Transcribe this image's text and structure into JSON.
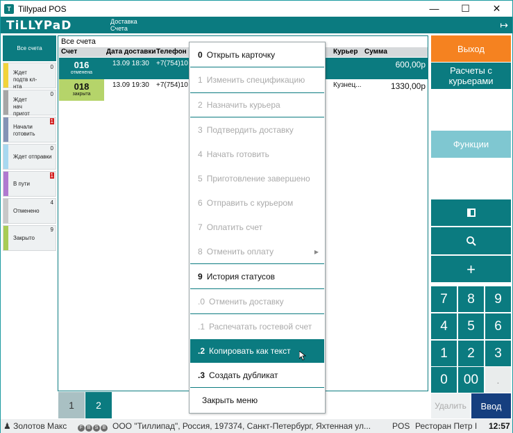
{
  "window": {
    "title": "Tillypad POS"
  },
  "header": {
    "logo": "TiLLYPaD",
    "section": "Доставка",
    "subsection": "Счета"
  },
  "sidebar": {
    "items": [
      {
        "label": "Все счета",
        "count": "",
        "color": ""
      },
      {
        "label": "Ждет подтв кл-нта",
        "count": "0",
        "color": "#f2d33a"
      },
      {
        "label": "Ждет нач пригот",
        "count": "0",
        "color": "#a6a6a6"
      },
      {
        "label": "Начали готовить",
        "count": "1",
        "color": "#8493b5",
        "alert": true
      },
      {
        "label": "Ждет отправки",
        "count": "0",
        "color": "#a8d8f0"
      },
      {
        "label": "В пути",
        "count": "1",
        "color": "#b07ad0",
        "alert": true
      },
      {
        "label": "Отменено",
        "count": "4",
        "color": "#c8c8c8"
      },
      {
        "label": "Закрыто",
        "count": "9",
        "color": "#a8cc55"
      }
    ]
  },
  "table": {
    "caption": "Все счета",
    "columns": [
      "Счет",
      "Дата доставки",
      "Телефон",
      "Курьер",
      "Сумма"
    ],
    "rows": [
      {
        "num": "016",
        "status": "отменена",
        "date": "13.09 18:30",
        "phone": "+7(754)10",
        "courier": "",
        "sum": "600,00р"
      },
      {
        "num": "018",
        "status": "закрыта",
        "date": "13.09 19:30",
        "phone": "+7(754)10",
        "courier": "Кузнец...",
        "sum": "1330,00р"
      }
    ]
  },
  "pager": {
    "pages": [
      "1",
      "2"
    ],
    "active": "2"
  },
  "right_panel": {
    "exit": "Выход",
    "couriers": "Расчеты с курьерами",
    "functions": "Функции",
    "delete": "Удалить",
    "enter": "Ввод",
    "keys": [
      "7",
      "8",
      "9",
      "4",
      "5",
      "6",
      "1",
      "2",
      "3",
      "0",
      "00",
      "."
    ],
    "plus": "+"
  },
  "context_menu": {
    "items": [
      {
        "key": "0",
        "label": "Открыть карточку",
        "enabled": true
      },
      {
        "key": "1",
        "label": "Изменить спецификацию",
        "enabled": false
      },
      {
        "key": "2",
        "label": "Назначить курьера",
        "enabled": false
      },
      {
        "key": "3",
        "label": "Подтвердить доставку",
        "enabled": false
      },
      {
        "key": "4",
        "label": "Начать готовить",
        "enabled": false
      },
      {
        "key": "5",
        "label": "Приготовление завершено",
        "enabled": false
      },
      {
        "key": "6",
        "label": "Отправить с курьером",
        "enabled": false
      },
      {
        "key": "7",
        "label": "Оплатить счет",
        "enabled": false
      },
      {
        "key": "8",
        "label": "Отменить оплату",
        "enabled": false
      },
      {
        "key": "9",
        "label": "История статусов",
        "enabled": true
      },
      {
        "key": ".0",
        "label": "Отменить доставку",
        "enabled": false
      },
      {
        "key": ".1",
        "label": "Распечатать гостевой счет",
        "enabled": false
      },
      {
        "key": ".2",
        "label": "Копировать как текст",
        "enabled": true
      },
      {
        "key": ".3",
        "label": "Создать дубликат",
        "enabled": true
      },
      {
        "key": "",
        "label": "Закрыть меню",
        "enabled": true
      }
    ]
  },
  "statusbar": {
    "user": "Золотов Макс",
    "badges": [
      "F",
      "B",
      "S",
      "B"
    ],
    "company": "ООО \"Тиллипад\", Россия, 197374, Санкт-Петербург, Яхтенная ул...",
    "mode": "POS",
    "place": "Ресторан Петр I",
    "time": "12:57"
  },
  "colors": {
    "teal": "#0b7b80",
    "orange": "#f58220",
    "navy": "#163f7f",
    "light_teal": "#7fc7d1"
  }
}
